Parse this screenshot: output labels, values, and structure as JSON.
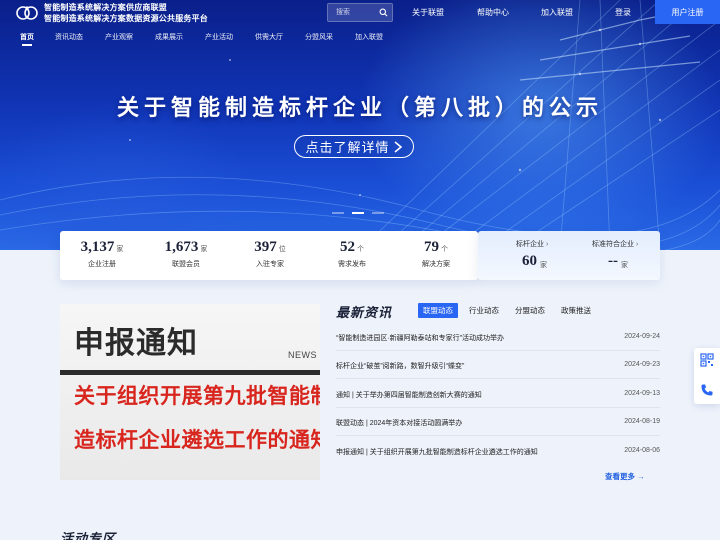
{
  "header": {
    "title_line1": "智能制造系统解决方案供应商联盟",
    "title_line2": "智能制造系统解决方案数据资源公共服务平台",
    "search_placeholder": "搜索",
    "links": [
      "关于联盟",
      "帮助中心",
      "加入联盟",
      "登录"
    ],
    "register": "用户注册",
    "brand_color": "#2a66f4"
  },
  "nav": {
    "items": [
      "首页",
      "资讯动态",
      "产业观察",
      "成果展示",
      "产业活动",
      "供需大厅",
      "分盟风采",
      "加入联盟"
    ]
  },
  "banner": {
    "title": "关于智能制造标杆企业（第八批）的公示",
    "button": "点击了解详情"
  },
  "stats": [
    {
      "value": "3,137",
      "unit": "家",
      "label": "企业注册"
    },
    {
      "value": "1,673",
      "unit": "家",
      "label": "联盟会员"
    },
    {
      "value": "397",
      "unit": "位",
      "label": "入驻专家"
    },
    {
      "value": "52",
      "unit": "个",
      "label": "需求发布"
    },
    {
      "value": "79",
      "unit": "个",
      "label": "解决方案"
    }
  ],
  "benchmark": [
    {
      "label": "标杆企业",
      "value": "60",
      "unit": "家"
    },
    {
      "label": "标准符合企业",
      "value": "--",
      "unit": "家"
    }
  ],
  "feature_image": {
    "heading": "申报通知",
    "tag": "NEWS",
    "line1": "关于组织开展第九批智能制",
    "line2": "造标杆企业遴选工作的通知"
  },
  "news": {
    "title": "最新资讯",
    "tabs": [
      "联盟动态",
      "行业动态",
      "分盟动态",
      "政策推送"
    ],
    "items": [
      {
        "title": "“智能制造进园区·新疆阿勒泰站和专家行”活动成功举办",
        "date": "2024-09-24"
      },
      {
        "title": "标杆企业“破茧”阅新路，数智升级引“蝶变”",
        "date": "2024-09-23"
      },
      {
        "title": "通知 | 关于举办第四届智能制造创新大赛的通知",
        "date": "2024-09-13"
      },
      {
        "title": "联盟动态 | 2024年资本对接活动圆满举办",
        "date": "2024-08-19"
      },
      {
        "title": "申报通知 | 关于组织开展第九批智能制造标杆企业遴选工作的通知",
        "date": "2024-08-06"
      }
    ],
    "more": "查看更多 →"
  },
  "activity": {
    "title": "活动专区"
  }
}
